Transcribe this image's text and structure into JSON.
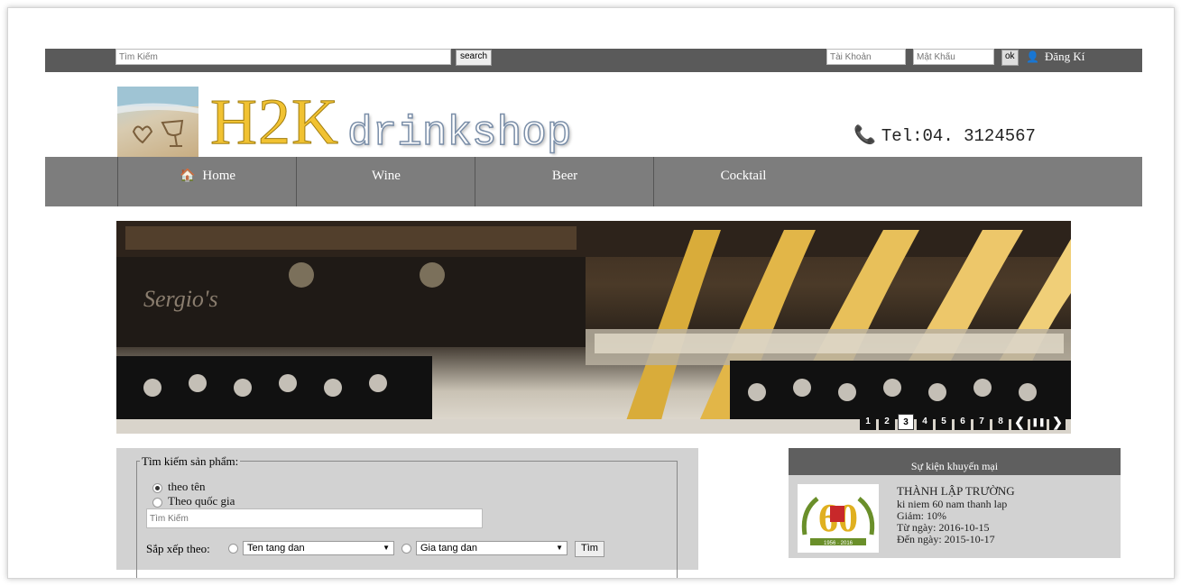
{
  "topbar": {
    "search_placeholder": "Tìm Kiếm",
    "search_button": "search",
    "account_placeholder": "Tài Khoản",
    "password_placeholder": "Mật Khẩu",
    "ok_button": "ok",
    "register_label": "Đăng Kí"
  },
  "header": {
    "logo_main": "H2K",
    "logo_sub": "drinkshop",
    "phone": "Tel:04. 3124567"
  },
  "nav": {
    "items": [
      {
        "label": "Home"
      },
      {
        "label": "Wine"
      },
      {
        "label": "Beer"
      },
      {
        "label": "Cocktail"
      }
    ]
  },
  "banner": {
    "sign_text": "Sergio's",
    "pages": [
      "1",
      "2",
      "3",
      "4",
      "5",
      "6",
      "7",
      "8"
    ],
    "active_page": "3",
    "prev_glyph": "❮",
    "pause_glyph": "❚❚",
    "next_glyph": "❯"
  },
  "product_search": {
    "legend": "Tìm kiếm sản phẩm:",
    "option_name": "theo tên",
    "option_country": "Theo quốc gia",
    "search_placeholder": "Tìm Kiếm",
    "sort_label": "Sắp xếp theo:",
    "sort_name_value": "Ten tang dan",
    "sort_price_value": "Gia tang dan",
    "find_button": "Tìm"
  },
  "promo": {
    "header": "Sự kiện khuyến mại",
    "title": "THÀNH LẬP TRƯỜNG",
    "description": "ki niem 60 nam thanh lap",
    "discount": "Giảm: 10%",
    "from": "Từ ngày: 2016-10-15",
    "to": "Đến ngày: 2015-10-17",
    "badge_number": "60",
    "badge_years": "1956 · 2016"
  },
  "colors": {
    "topbar": "#5a5a5a",
    "nav": "#7d7d7d",
    "panel": "#d2d2d2",
    "logo_gold": "#f1c232"
  }
}
